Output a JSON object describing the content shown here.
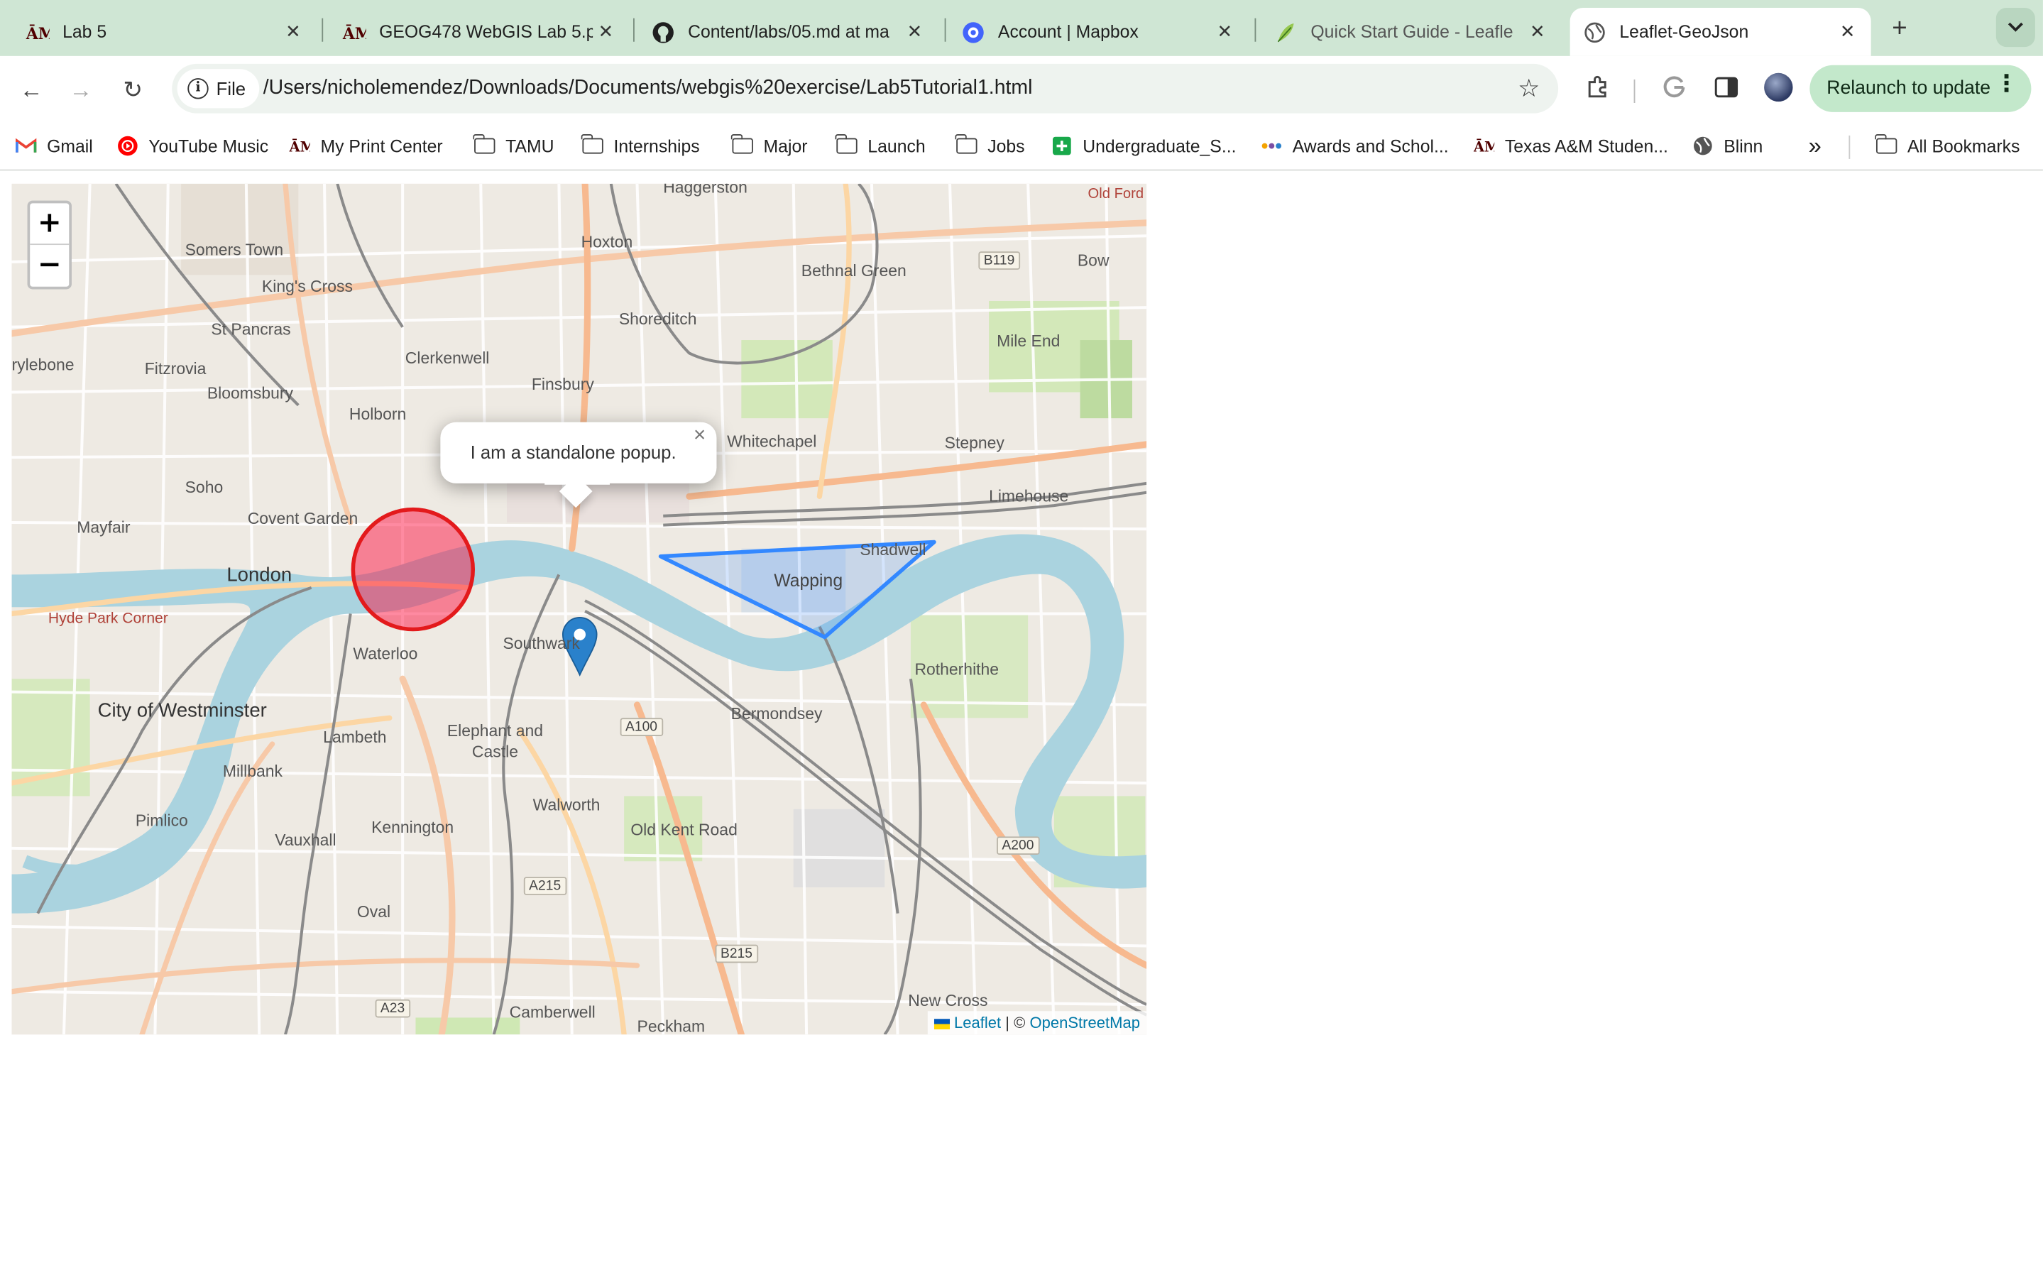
{
  "browser": {
    "tabs": [
      {
        "title": "Lab 5",
        "icon": "tamu-icon",
        "active": false
      },
      {
        "title": "GEOG478 WebGIS Lab 5.p",
        "icon": "tamu-icon",
        "active": false
      },
      {
        "title": "Content/labs/05.md at ma",
        "icon": "github-icon",
        "active": false
      },
      {
        "title": "Account | Mapbox",
        "icon": "mapbox-icon",
        "active": false
      },
      {
        "title": "Quick Start Guide - Leafle",
        "icon": "leaflet-icon",
        "active": false
      },
      {
        "title": "Leaflet-GeoJson",
        "icon": "globe-icon",
        "active": true
      }
    ],
    "new_tab_symbol": "+",
    "close_symbol": "✕",
    "toolbar": {
      "back_symbol": "←",
      "forward_symbol": "→",
      "reload_symbol": "↻",
      "chip_label": "File",
      "url": "/Users/nicholemendez/Downloads/Documents/webgis%20exercise/Lab5Tutorial1.html",
      "bookmark_star_symbol": "☆",
      "relaunch_label": "Relaunch to update",
      "menu_symbol": "⋮"
    },
    "bookmarks": [
      {
        "label": "Gmail",
        "icon": "gmail-icon"
      },
      {
        "label": "YouTube Music",
        "icon": "youtube-music-icon"
      },
      {
        "label": "My Print Center",
        "icon": "tamu-icon"
      },
      {
        "label": "TAMU",
        "icon": "folder-icon"
      },
      {
        "label": "Internships",
        "icon": "folder-icon"
      },
      {
        "label": "Major",
        "icon": "folder-icon"
      },
      {
        "label": "Launch",
        "icon": "folder-icon"
      },
      {
        "label": "Jobs",
        "icon": "folder-icon"
      },
      {
        "label": "Undergraduate_S...",
        "icon": "green-plus-icon"
      },
      {
        "label": "Awards and Schol...",
        "icon": "dots-icon"
      },
      {
        "label": "Texas A&M Studen...",
        "icon": "tamu-icon"
      },
      {
        "label": "Blinn",
        "icon": "globe-icon"
      }
    ],
    "more_bookmarks_symbol": "»",
    "all_bookmarks_label": "All Bookmarks"
  },
  "map": {
    "zoom_in": "+",
    "zoom_out": "−",
    "popup_text": "I am a standalone popup.",
    "popup_close": "×",
    "attribution": {
      "leaflet": "Leaflet",
      "separator": " | © ",
      "osm": "OpenStreetMap"
    },
    "circle": {
      "stroke": "#e31a1c",
      "fill": "#f03",
      "fill_opacity": 0.5
    },
    "polygon": {
      "stroke": "#3388ff"
    },
    "marker": {
      "color": "#2a81cb"
    },
    "place_labels": [
      "Haggerston",
      "Old Ford",
      "Somers Town",
      "Hoxton",
      "Bethnal Green",
      "B119",
      "Bow",
      "King's Cross",
      "Shoreditch",
      "St Pancras",
      "Mile End",
      "rylebone",
      "Fitzrovia",
      "Clerkenwell",
      "Bloomsbury",
      "Finsbury",
      "Holborn",
      "Whitechapel",
      "Stepney",
      "Soho",
      "Mayfair",
      "Covent Garden",
      "Limehouse",
      "London",
      "Wapping",
      "Shadwell",
      "Hyde Park Corner",
      "Southwark",
      "Waterloo",
      "Rotherhithe",
      "City of Westminster",
      "Bermondsey",
      "Lambeth",
      "Elephant and Castle",
      "A100",
      "Millbank",
      "Pimlico",
      "Walworth",
      "Old Kent Road",
      "Kennington",
      "Vauxhall",
      "A200",
      "A215",
      "Oval",
      "B215",
      "A23",
      "Camberwell",
      "New Cross",
      "Peckham"
    ]
  }
}
